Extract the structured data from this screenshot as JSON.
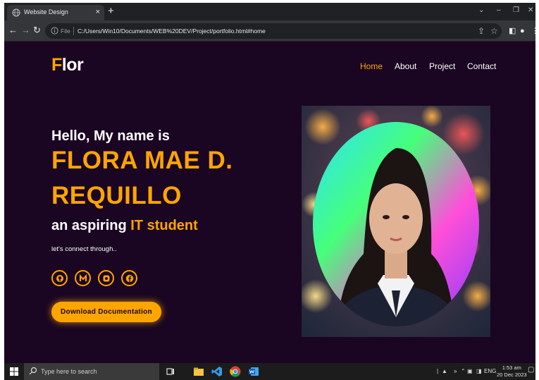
{
  "browser": {
    "tab_title": "Website Design",
    "tab_close": "×",
    "new_tab": "+",
    "url_scheme": "File",
    "url": "C:/Users/Win10/Documents/WEB%20DEV/Project/portfolio.html#home"
  },
  "site": {
    "logo_accent": "F",
    "logo_rest": "lor",
    "nav": [
      "Home",
      "About",
      "Project",
      "Contact"
    ],
    "active_nav": "Home",
    "hello": "Hello, My name is",
    "name_line1": "FLORA MAE D.",
    "name_line2": "REQUILLO",
    "aspiring_prefix": "an aspiring ",
    "aspiring_accent": "IT student",
    "connect": "let's connect through..",
    "social_icons": [
      "github-icon",
      "medium-icon",
      "instagram-icon",
      "facebook-icon"
    ],
    "download_label": "Download Documentation"
  },
  "taskbar": {
    "search_placeholder": "Type here to search",
    "tray_lang": "ENG",
    "time": "1:53 am",
    "date": "20 Dec 2023"
  },
  "colors": {
    "accent": "#ffa500",
    "background": "#1a0522"
  }
}
